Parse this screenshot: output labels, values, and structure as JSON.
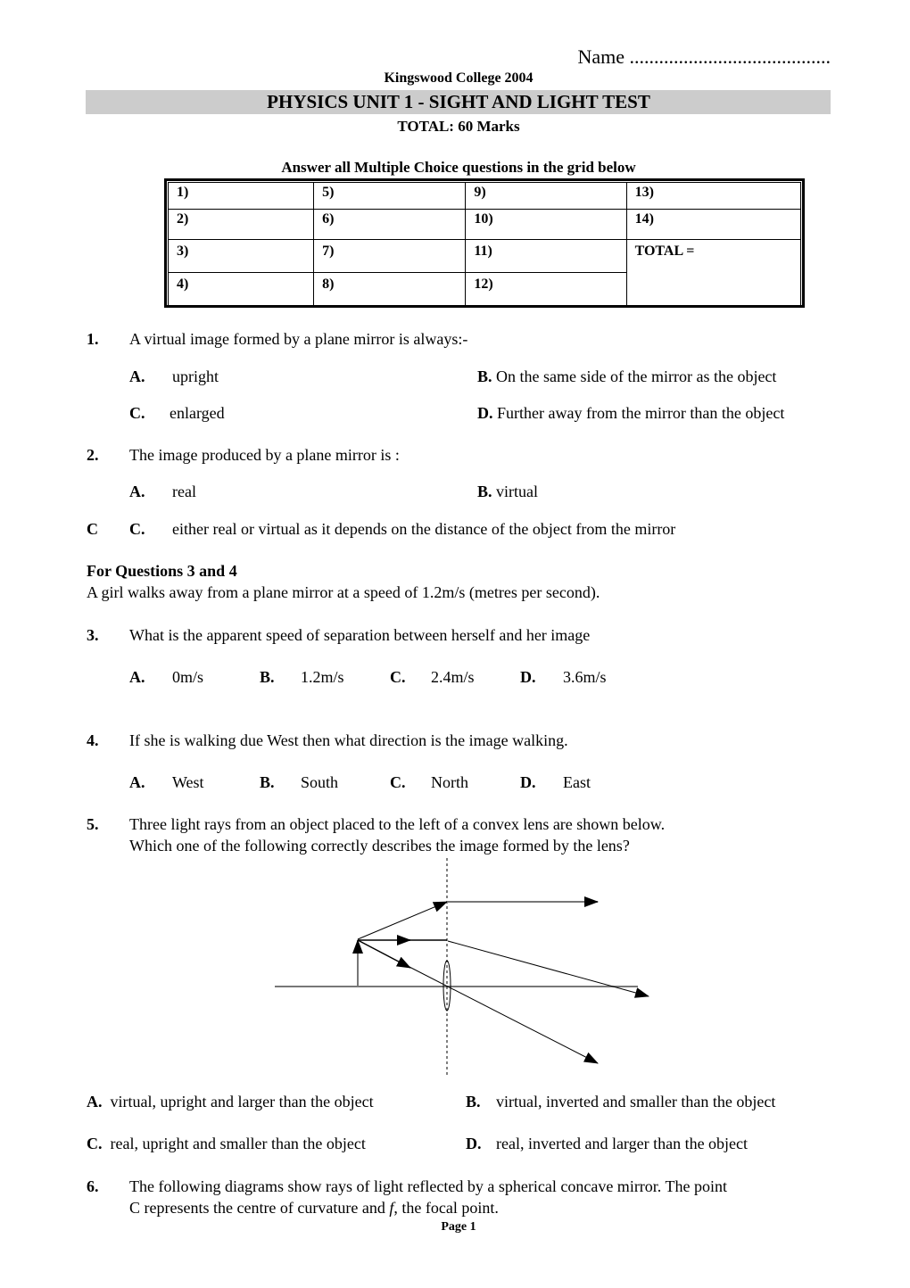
{
  "header": {
    "name_label": "Name .........................................",
    "college": "Kingswood College 2004",
    "title": "PHYSICS UNIT 1 - SIGHT AND LIGHT  TEST",
    "total_marks": "TOTAL: 60 Marks",
    "banner_color": "#cccccc"
  },
  "answer_grid": {
    "instruction": "Answer all Multiple Choice questions in the grid below",
    "rows": [
      [
        "1)",
        "5)",
        "9)",
        "13)"
      ],
      [
        "2)",
        "6)",
        "10)",
        "14)"
      ],
      [
        "3)",
        "7)",
        "11)",
        "TOTAL ="
      ],
      [
        "4)",
        "8)",
        "12)"
      ]
    ]
  },
  "questions": {
    "q1": {
      "number": "1.",
      "text": "A virtual image formed by a plane mirror is always:-",
      "options": [
        {
          "letter": "A.",
          "text": "upright"
        },
        {
          "letter": "B.",
          "text": "On the same side of the mirror as the object"
        },
        {
          "letter": "C.",
          "text": "enlarged"
        },
        {
          "letter": "D.",
          "text": "Further away from the mirror than the object"
        }
      ]
    },
    "q2": {
      "number": "2.",
      "text": "The image produced by a plane mirror is :",
      "options": [
        {
          "letter": "A.",
          "text": "real"
        },
        {
          "letter": "B.",
          "text": "virtual"
        },
        {
          "letter": "C.",
          "text": "either real or virtual as it depends on the distance of the object from the mirror"
        }
      ],
      "stray_mark": "C"
    },
    "context_3_4": {
      "heading": "For Questions 3 and 4",
      "text": "A girl walks away from a plane mirror at a speed of 1.2m/s (metres per second)."
    },
    "q3": {
      "number": "3.",
      "text": "What is the apparent speed of separation between herself and her image",
      "options": [
        {
          "letter": "A.",
          "text": "0m/s"
        },
        {
          "letter": "B.",
          "text": "1.2m/s"
        },
        {
          "letter": "C.",
          "text": "2.4m/s"
        },
        {
          "letter": "D.",
          "text": "3.6m/s"
        }
      ]
    },
    "q4": {
      "number": "4.",
      "text": "If she is walking due West then what direction is the image walking.",
      "options": [
        {
          "letter": "A.",
          "text": "West"
        },
        {
          "letter": "B.",
          "text": "South"
        },
        {
          "letter": "C.",
          "text": "North"
        },
        {
          "letter": "D.",
          "text": "East"
        }
      ]
    },
    "q5": {
      "number": "5.",
      "text_line1": "Three light rays from an object placed to the left of a convex lens are shown below.",
      "text_line2": "Which one of the following correctly describes the image formed by the lens?",
      "diagram": "ray-diagram-convex-lens",
      "options": [
        {
          "letter": "A.",
          "text": "virtual, upright and larger than the object"
        },
        {
          "letter": "B.",
          "text": "virtual, inverted and smaller than the object"
        },
        {
          "letter": "C.",
          "text": "real, upright and smaller than the object"
        },
        {
          "letter": "D.",
          "text": "real, inverted and larger than the object"
        }
      ]
    },
    "q6": {
      "number": "6.",
      "text_line1": "The following diagrams show rays of light reflected by a spherical concave mirror.  The point",
      "text_line2_pre": "C represents the centre of curvature and ",
      "text_line2_italic": "f",
      "text_line2_post": ", the focal point."
    }
  },
  "footer": {
    "page_label": "Page 1"
  }
}
